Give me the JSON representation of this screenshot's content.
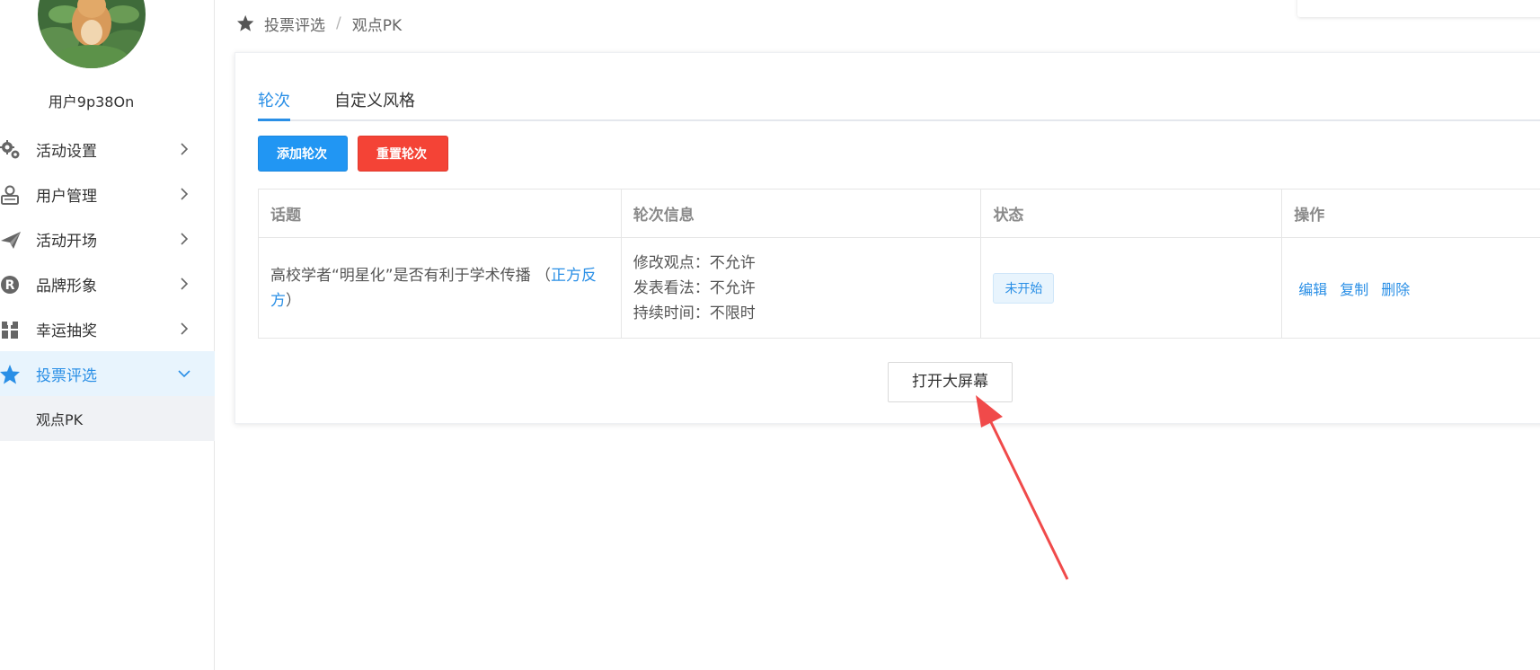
{
  "sidebar": {
    "username": "用户9p38On",
    "items": [
      {
        "label": "活动设置",
        "icon": "gears-icon"
      },
      {
        "label": "用户管理",
        "icon": "user-card-icon"
      },
      {
        "label": "活动开场",
        "icon": "paper-plane-icon"
      },
      {
        "label": "品牌形象",
        "icon": "registered-icon"
      },
      {
        "label": "幸运抽奖",
        "icon": "gift-icon"
      },
      {
        "label": "投票评选",
        "icon": "star-icon"
      }
    ],
    "submenu": [
      {
        "label": "观点PK"
      }
    ]
  },
  "breadcrumb": {
    "parent": "投票评选",
    "separator": "/",
    "current": "观点PK"
  },
  "tabs": [
    {
      "label": "轮次"
    },
    {
      "label": "自定义风格"
    }
  ],
  "buttons": {
    "add_round": "添加轮次",
    "reset_round": "重置轮次",
    "open_screen": "打开大屏幕"
  },
  "table": {
    "headers": [
      "话题",
      "轮次信息",
      "状态",
      "操作"
    ],
    "rows": [
      {
        "topic": "高校学者“明星化”是否有利于学术传播",
        "topic_prefix": " （",
        "topic_link": "正方反方",
        "topic_suffix": "）",
        "info": [
          "修改观点：不允许",
          "发表看法：不允许",
          "持续时间：不限时"
        ],
        "status": "未开始",
        "actions": [
          "编辑",
          "复制",
          "删除"
        ]
      }
    ]
  },
  "colors": {
    "accent": "#2a8fe6",
    "primary_button": "#2196f3",
    "danger_button": "#f44336",
    "annotation_arrow": "#f04a4a"
  }
}
